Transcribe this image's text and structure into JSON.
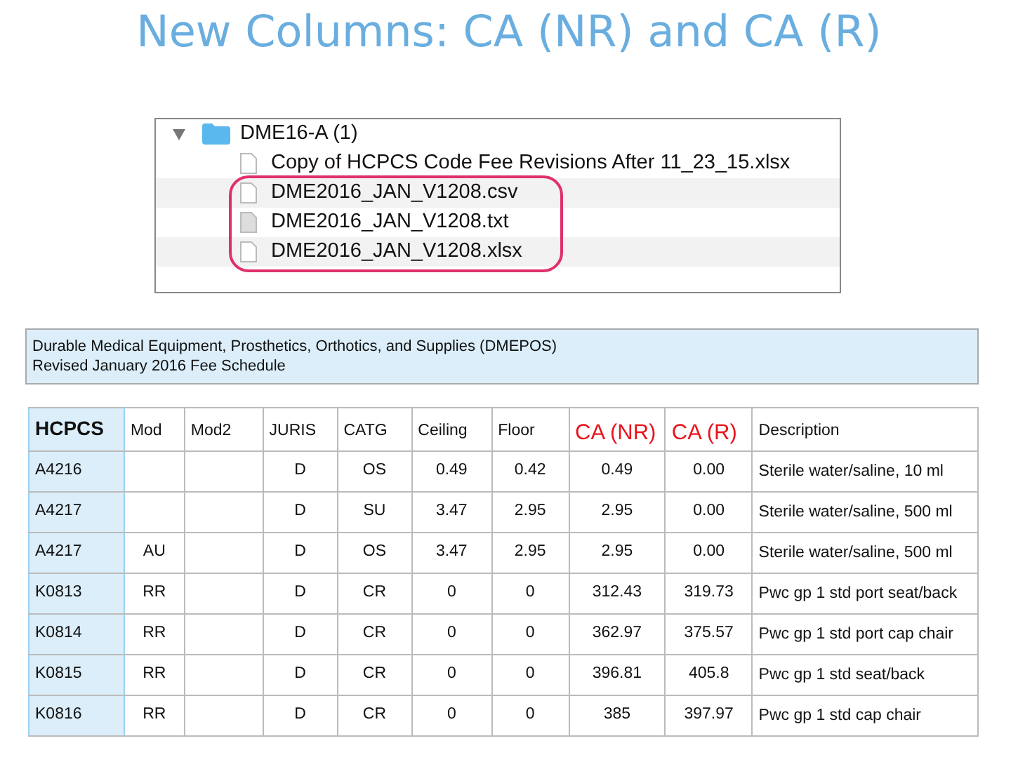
{
  "title": "New Columns: CA (NR) and CA (R)",
  "file_browser": {
    "folder": {
      "name": "DME16-A (1)",
      "expanded": true
    },
    "files": [
      {
        "name": "Copy of HCPCS Code Fee Revisions After 11_23_15.xlsx",
        "kind": "document",
        "circled": false
      },
      {
        "name": "DME2016_JAN_V1208.csv",
        "kind": "document",
        "circled": true
      },
      {
        "name": "DME2016_JAN_V1208.txt",
        "kind": "text",
        "circled": true
      },
      {
        "name": "DME2016_JAN_V1208.xlsx",
        "kind": "document",
        "circled": true
      }
    ]
  },
  "info_box": {
    "lines": [
      "Durable Medical Equipment, Prosthetics, Orthotics, and Supplies (DMEPOS)",
      "Revised January 2016 Fee Schedule"
    ]
  },
  "table": {
    "columns": [
      {
        "label": "HCPCS",
        "kind": "key"
      },
      {
        "label": "Mod",
        "kind": "plain"
      },
      {
        "label": "Mod2",
        "kind": "plain"
      },
      {
        "label": "JURIS",
        "kind": "plain"
      },
      {
        "label": "CATG",
        "kind": "plain"
      },
      {
        "label": "Ceiling",
        "kind": "plain"
      },
      {
        "label": "Floor",
        "kind": "plain"
      },
      {
        "label": "CA (NR)",
        "kind": "new"
      },
      {
        "label": "CA (R)",
        "kind": "new"
      },
      {
        "label": "Description",
        "kind": "text"
      }
    ],
    "rows": [
      [
        "A4216",
        "",
        "",
        "D",
        "OS",
        "0.49",
        "0.42",
        "0.49",
        "0.00",
        "Sterile water/saline, 10 ml"
      ],
      [
        "A4217",
        "",
        "",
        "D",
        "SU",
        "3.47",
        "2.95",
        "2.95",
        "0.00",
        "Sterile water/saline, 500 ml"
      ],
      [
        "A4217",
        "AU",
        "",
        "D",
        "OS",
        "3.47",
        "2.95",
        "2.95",
        "0.00",
        "Sterile water/saline, 500 ml"
      ],
      [
        "K0813",
        "RR",
        "",
        "D",
        "CR",
        "0",
        "0",
        "312.43",
        "319.73",
        "Pwc gp 1 std port seat/back"
      ],
      [
        "K0814",
        "RR",
        "",
        "D",
        "CR",
        "0",
        "0",
        "362.97",
        "375.57",
        "Pwc gp 1 std port cap chair"
      ],
      [
        "K0815",
        "RR",
        "",
        "D",
        "CR",
        "0",
        "0",
        "396.81",
        "405.8",
        "Pwc gp 1 std seat/back"
      ],
      [
        "K0816",
        "RR",
        "",
        "D",
        "CR",
        "0",
        "0",
        "385",
        "397.97",
        "Pwc gp 1 std cap chair"
      ]
    ]
  }
}
